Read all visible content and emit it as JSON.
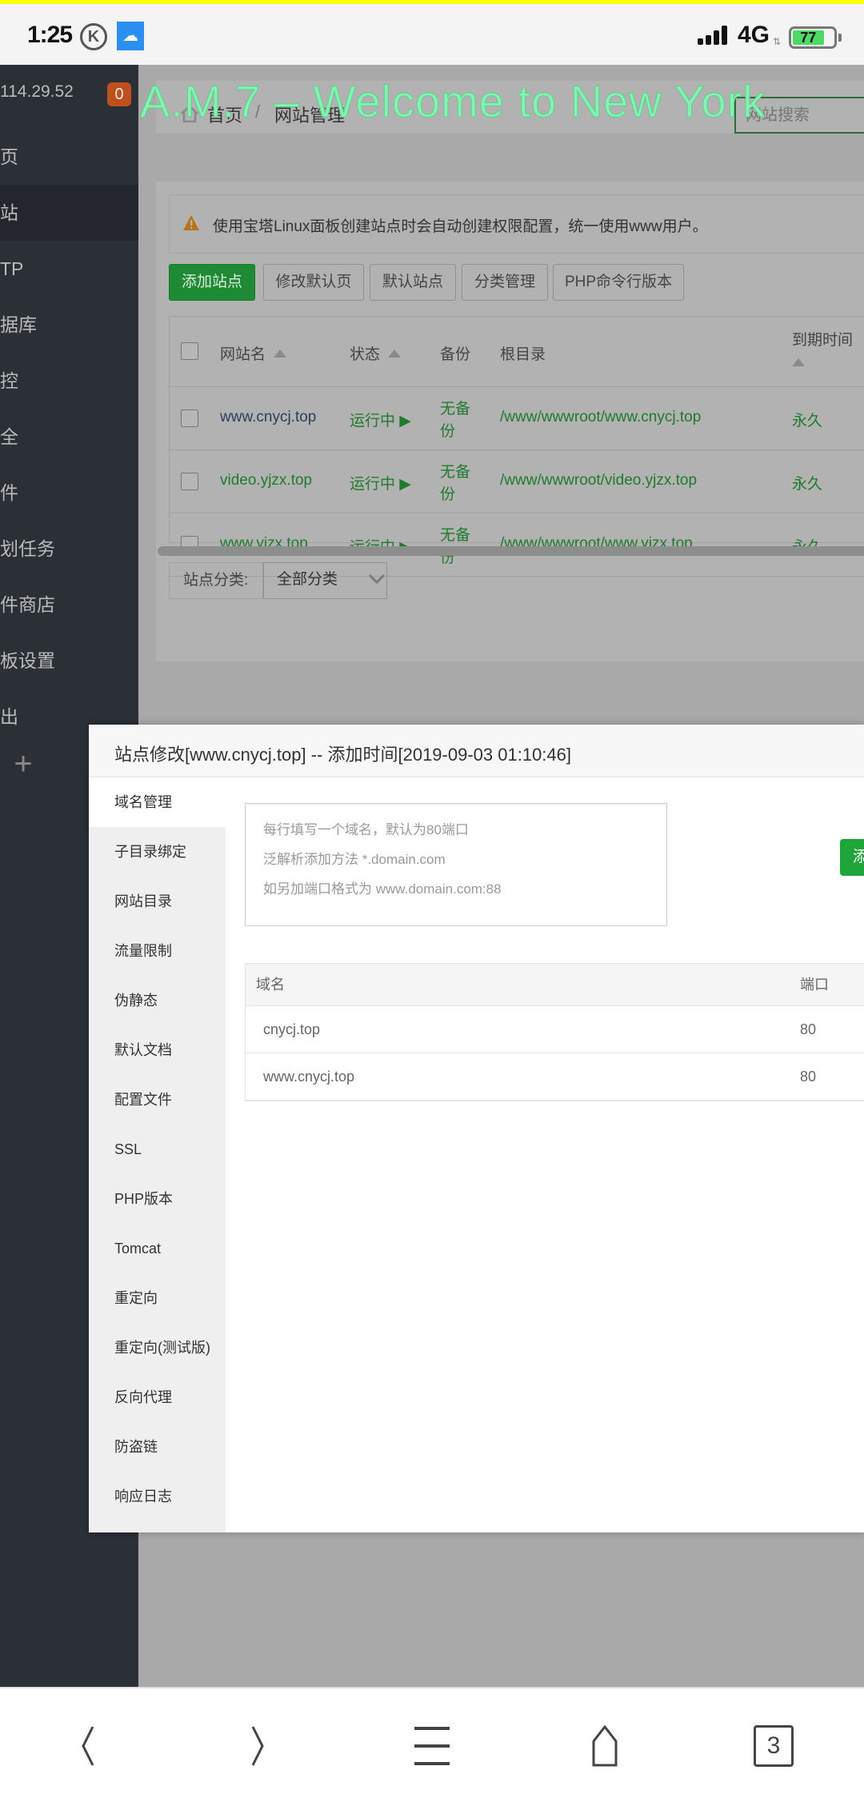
{
  "status_bar": {
    "time": "1:25",
    "k_icon": "K",
    "network": "4G",
    "battery": "77",
    "battery_level_percent": 77
  },
  "sidebar": {
    "ip": "114.29.52",
    "badge": "0",
    "items": [
      {
        "label": "页",
        "active": false
      },
      {
        "label": "站",
        "active": true
      },
      {
        "label": "TP",
        "active": false
      },
      {
        "label": "据库",
        "active": false
      },
      {
        "label": "控",
        "active": false
      },
      {
        "label": "全",
        "active": false
      },
      {
        "label": "件",
        "active": false
      },
      {
        "label": "划任务",
        "active": false
      },
      {
        "label": "件商店",
        "active": false
      },
      {
        "label": "板设置",
        "active": false
      },
      {
        "label": "出",
        "active": false
      }
    ],
    "plus": "+"
  },
  "watermark": "A.M.7 – Welcome to New York",
  "breadcrumb": {
    "home": "首页",
    "separator": "/",
    "current": "网站管理"
  },
  "search": {
    "placeholder": "网站搜索"
  },
  "alert": {
    "text": "使用宝塔Linux面板创建站点时会自动创建权限配置，统一使用www用户。"
  },
  "toolbar": {
    "add_site": "添加站点",
    "edit_default_page": "修改默认页",
    "default_site": "默认站点",
    "category_manage": "分类管理",
    "php_cli_version": "PHP命令行版本"
  },
  "site_table": {
    "headers": {
      "name": "网站名",
      "status": "状态",
      "backup": "备份",
      "root": "根目录",
      "expiry": "到期时间"
    },
    "rows": [
      {
        "name": "www.cnycj.top",
        "status": "运行中",
        "backup_1": "无备",
        "backup_2": "份",
        "root": "/www/wwwroot/www.cnycj.top",
        "expiry": "永久"
      },
      {
        "name": "video.yjzx.top",
        "status": "运行中",
        "backup_1": "无备",
        "backup_2": "份",
        "root": "/www/wwwroot/video.yjzx.top",
        "expiry": "永久"
      },
      {
        "name": "www.yjzx.top",
        "status": "运行中",
        "backup_1": "无备",
        "backup_2": "份",
        "root": "/www/wwwroot/www.yjzx.top",
        "expiry": "永久"
      }
    ]
  },
  "category_filter": {
    "label": "站点分类:",
    "selected": "全部分类"
  },
  "modal": {
    "title": "站点修改[www.cnycj.top] -- 添加时间[2019-09-03 01:10:46]",
    "tabs": [
      {
        "label": "域名管理",
        "active": true
      },
      {
        "label": "子目录绑定",
        "active": false
      },
      {
        "label": "网站目录",
        "active": false
      },
      {
        "label": "流量限制",
        "active": false
      },
      {
        "label": "伪静态",
        "active": false
      },
      {
        "label": "默认文档",
        "active": false
      },
      {
        "label": "配置文件",
        "active": false
      },
      {
        "label": "SSL",
        "active": false
      },
      {
        "label": "PHP版本",
        "active": false
      },
      {
        "label": "Tomcat",
        "active": false
      },
      {
        "label": "重定向",
        "active": false
      },
      {
        "label": "重定向(测试版)",
        "active": false
      },
      {
        "label": "反向代理",
        "active": false
      },
      {
        "label": "防盗链",
        "active": false
      },
      {
        "label": "响应日志",
        "active": false
      }
    ],
    "domain_input": {
      "value": "",
      "placeholder_lines": [
        "每行填写一个域名，默认为80端口",
        "泛解析添加方法 *.domain.com",
        "如另加端口格式为 www.domain.com:88"
      ]
    },
    "add_button": "添加",
    "domain_table": {
      "headers": {
        "domain": "域名",
        "port": "端口"
      },
      "rows": [
        {
          "domain": "cnycj.top",
          "port": "80"
        },
        {
          "domain": "www.cnycj.top",
          "port": "80"
        }
      ]
    }
  },
  "bottom_nav": {
    "tabs_count": "3"
  },
  "colors": {
    "accent_green": "#20a53a",
    "sidebar_bg": "#2b2f36",
    "badge": "#c0501b",
    "watermark": "#86f2b1"
  }
}
